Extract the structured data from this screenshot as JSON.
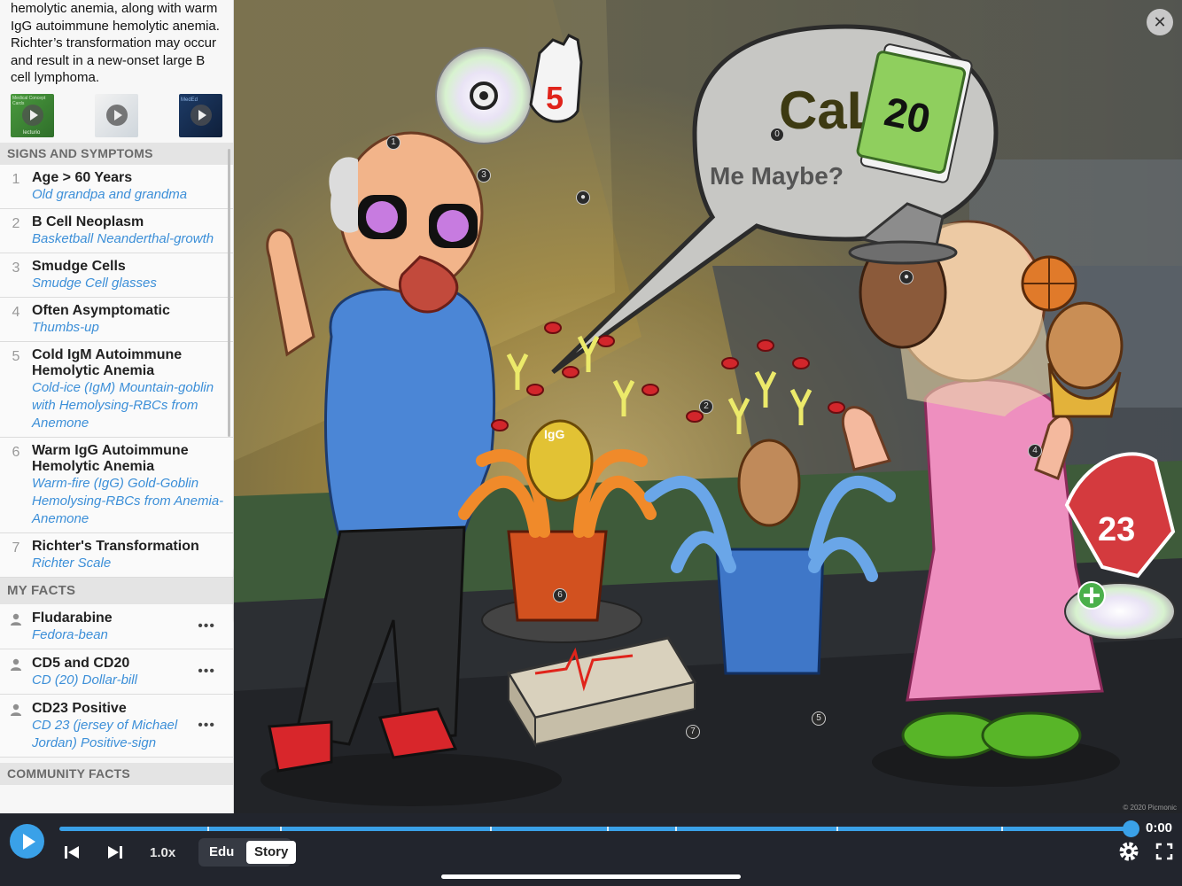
{
  "intro": {
    "text": "hemolytic anemia, along with warm IgG autoimmune hemolytic anemia. Richter’s transformation may occur and result in a new-onset large B cell lymphoma."
  },
  "thumbnails": [
    {
      "caption": "Medical Concept Cards",
      "sub": "lecturio"
    },
    {
      "caption": "",
      "sub": ""
    },
    {
      "caption": "MedEd",
      "sub": ""
    }
  ],
  "signs_header": "SIGNS AND SYMPTOMS",
  "symptoms": [
    {
      "num": "1",
      "title": "Age > 60 Years",
      "sub": "Old grandpa and grandma"
    },
    {
      "num": "2",
      "title": "B Cell Neoplasm",
      "sub": "Basketball Neanderthal-growth"
    },
    {
      "num": "3",
      "title": "Smudge Cells",
      "sub": "Smudge Cell glasses"
    },
    {
      "num": "4",
      "title": "Often Asymptomatic",
      "sub": "Thumbs-up"
    },
    {
      "num": "5",
      "title": "Cold IgM Autoimmune Hemolytic Anemia",
      "sub": "Cold-ice (IgM) Mountain-goblin with Hemolysing-RBCs from Anemone"
    },
    {
      "num": "6",
      "title": "Warm IgG Autoimmune Hemolytic Anemia",
      "sub": "Warm-fire (IgG) Gold-Goblin Hemolysing-RBCs from Anemia-Anemone"
    },
    {
      "num": "7",
      "title": "Richter's Transformation",
      "sub": "Richter Scale"
    }
  ],
  "my_facts_header": "MY FACTS",
  "facts": [
    {
      "title": "Fludarabine",
      "sub": "Fedora-bean",
      "more": "•••"
    },
    {
      "title": "CD5 and CD20",
      "sub": "CD (20) Dollar-bill",
      "more": "•••"
    },
    {
      "title": "CD23 Positive",
      "sub": "CD 23 (jersey of Michael Jordan) Positive-sign",
      "more": "•••"
    }
  ],
  "community_header": "COMMUNITY FACTS",
  "scene": {
    "speech_title": "CaLL",
    "speech_sub": "Me Maybe?",
    "cd_label": "5",
    "bill_label": "20",
    "jersey_label": "23",
    "igg_label": "IgG",
    "markers": [
      "1",
      "0",
      "3",
      "2",
      "4",
      "6",
      "5",
      "7"
    ],
    "copyright": "© 2020 Picmonic",
    "close": "✕"
  },
  "player": {
    "speed": "1.0x",
    "time": "0:00",
    "modes": {
      "edu": "Edu",
      "story": "Story"
    },
    "progress": 1.0
  }
}
